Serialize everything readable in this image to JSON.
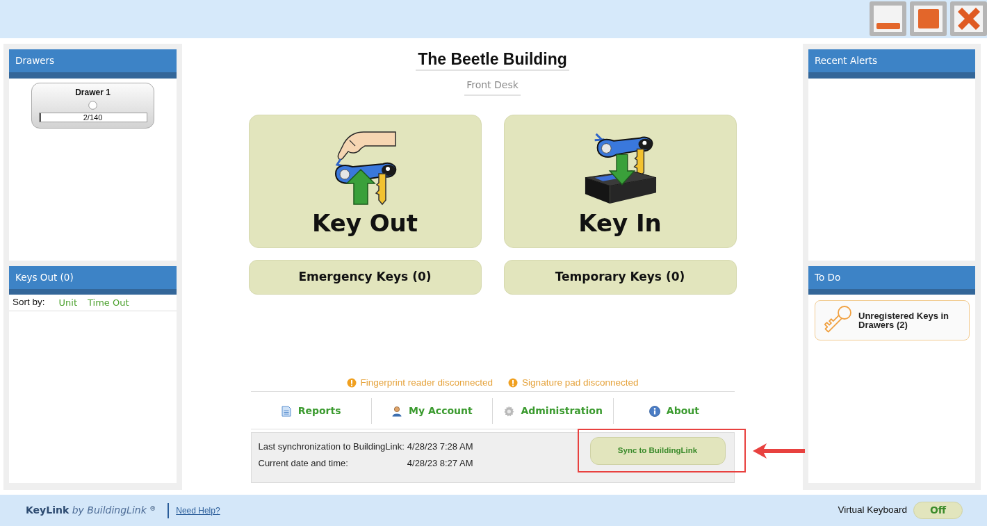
{
  "drawers_panel": {
    "title": "Drawers",
    "drawers": [
      {
        "name": "Drawer 1",
        "count": "2/140",
        "level": 0.014
      }
    ]
  },
  "keys_out_panel": {
    "title": "Keys Out (0)",
    "sort_label": "Sort by:",
    "sort_options": [
      {
        "label": "Unit"
      },
      {
        "label": "Time Out"
      }
    ]
  },
  "header": {
    "building": "The Beetle Building",
    "location": "Front Desk"
  },
  "actions": [
    {
      "label": "Key Out",
      "kind": "key_out"
    },
    {
      "label": "Key In",
      "kind": "key_in"
    }
  ],
  "key_lists": [
    {
      "label": "Emergency Keys (0)"
    },
    {
      "label": "Temporary Keys (0)"
    }
  ],
  "device_warnings": [
    "Fingerprint reader disconnected",
    "Signature pad disconnected"
  ],
  "nav": [
    {
      "label": "Reports",
      "kind": "reports"
    },
    {
      "label": "My Account",
      "kind": "account"
    },
    {
      "label": "Administration",
      "kind": "admin"
    },
    {
      "label": "About",
      "kind": "about"
    }
  ],
  "sync": {
    "rows": [
      {
        "label": "Last synchronization to BuildingLink:",
        "value": "4/28/23 7:28 AM"
      },
      {
        "label": "Current date and time:",
        "value": "4/28/23 8:27 AM"
      }
    ],
    "button": {
      "label": "Sync to BuildingLink",
      "highlighted": true
    }
  },
  "alerts_panel": {
    "title": "Recent Alerts"
  },
  "todo_panel": {
    "title": "To Do",
    "items": [
      {
        "label": "Unregistered Keys in Drawers (2)"
      }
    ]
  },
  "footer": {
    "brand": "**KeyLink** *by BuildingLink* $^{®}$",
    "help_link": "Need Help?",
    "virtual_keyboard": {
      "label": "Virtual Keyboard",
      "state_text": "Off",
      "on": false
    }
  }
}
